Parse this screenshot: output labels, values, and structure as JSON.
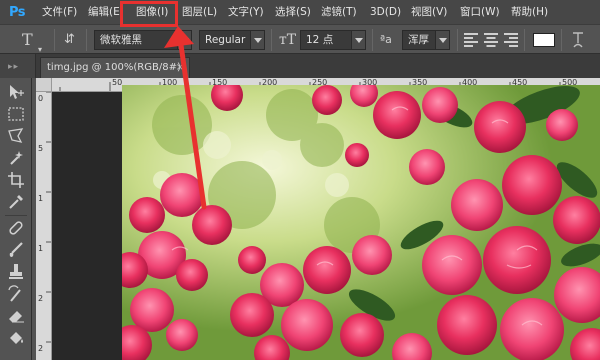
{
  "app": {
    "logo": "Ps"
  },
  "menubar": {
    "items": [
      {
        "label": "文件(F)"
      },
      {
        "label": "编辑(E)"
      },
      {
        "label": "图像(I)"
      },
      {
        "label": "图层(L)"
      },
      {
        "label": "文字(Y)"
      },
      {
        "label": "选择(S)"
      },
      {
        "label": "滤镜(T)"
      },
      {
        "label": "3D(D)"
      },
      {
        "label": "视图(V)"
      },
      {
        "label": "窗口(W)"
      },
      {
        "label": "帮助(H)"
      }
    ],
    "highlighted": "图像(I)"
  },
  "options": {
    "font_family": "微软雅黑",
    "font_style": "Regular",
    "font_size": "12 点",
    "antialias_label": "ªa",
    "antialias": "浑厚",
    "color_swatch": "#ffffff"
  },
  "document": {
    "tab_title": "timg.jpg @ 100%(RGB/8#)",
    "close": "×"
  },
  "rulers": {
    "top": [
      "50",
      "100",
      "150",
      "200",
      "250",
      "300",
      "350",
      "400",
      "450",
      "500"
    ],
    "left": [
      "0",
      "5",
      "1",
      "1",
      "2",
      "2"
    ]
  },
  "colors": {
    "highlight": "#e8312f",
    "accent": "#31a8ff"
  },
  "icons": {
    "type_tool": "T",
    "move_tool": "move-icon",
    "marquee_tool": "marquee-icon",
    "lasso_tool": "lasso-icon",
    "quick_select": "wand-icon",
    "crop_tool": "crop-icon",
    "eyedropper": "eyedropper-icon",
    "healing": "bandage-icon",
    "brush": "brush-icon",
    "stamp": "stamp-icon",
    "history_brush": "history-brush-icon",
    "eraser": "eraser-icon",
    "bucket": "bucket-icon"
  }
}
